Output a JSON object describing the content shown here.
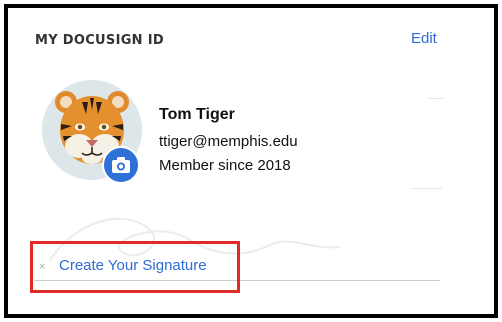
{
  "card": {
    "title": "MY DOCUSIGN ID",
    "edit_label": "Edit"
  },
  "profile": {
    "name": "Tom Tiger",
    "email": "ttiger@memphis.edu",
    "member_since": "Member since 2018",
    "avatar_icon": "tiger-avatar",
    "badge_icon": "camera-icon"
  },
  "signature": {
    "create_label": "Create Your Signature",
    "marker": "×"
  },
  "colors": {
    "link": "#2e6bd6",
    "badge": "#2f6fd8",
    "highlight": "#e02a2a"
  }
}
